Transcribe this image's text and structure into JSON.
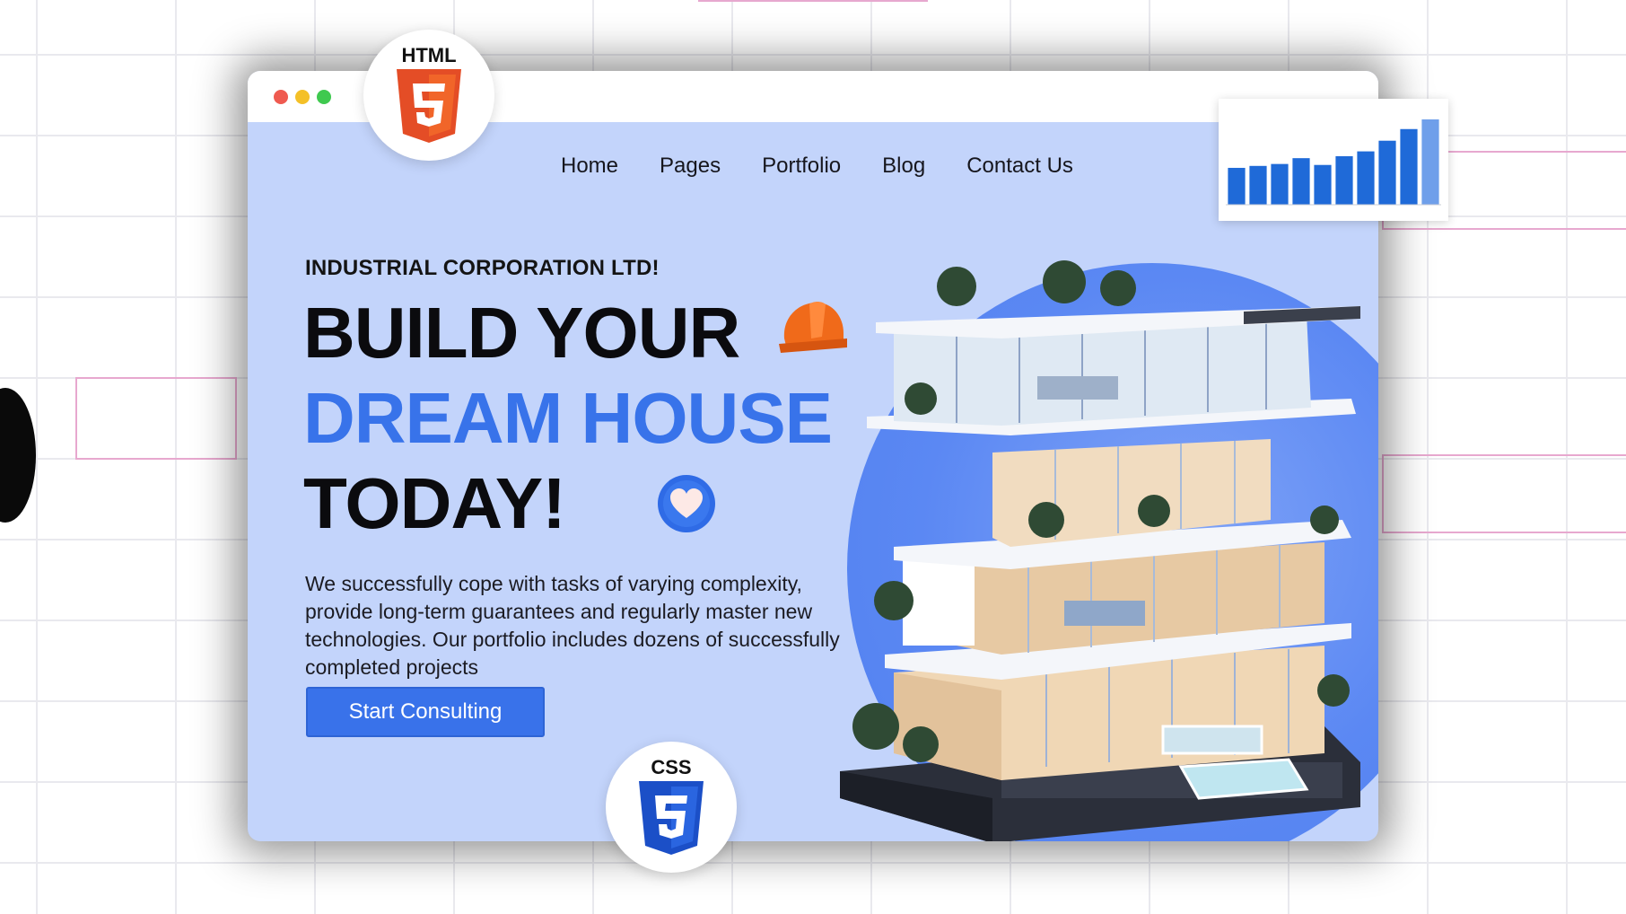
{
  "nav": {
    "items": [
      {
        "label": "Home"
      },
      {
        "label": "Pages"
      },
      {
        "label": "Portfolio"
      },
      {
        "label": "Blog"
      },
      {
        "label": "Contact Us"
      }
    ]
  },
  "hero": {
    "eyebrow": "INDUSTRIAL CORPORATION LTD!",
    "headline_line1": "BUILD YOUR",
    "headline_line2": "DREAM HOUSE",
    "headline_line3": "TODAY!",
    "description": "We successfully cope with tasks of varying complexity, provide long-term guarantees and regularly master new technologies. Our portfolio includes dozens of successfully completed projects",
    "cta_label": "Start Consulting"
  },
  "badges": {
    "html": {
      "label": "HTML",
      "icon": "html5-icon",
      "color": "#e44d26"
    },
    "css": {
      "label": "CSS",
      "icon": "css3-icon",
      "color": "#1572b6"
    }
  },
  "colors": {
    "page_bg": "#c3d4fb",
    "accent": "#3873ea",
    "headline_dark": "#0b0b0e"
  },
  "chart_data": {
    "type": "bar",
    "values": [
      38,
      40,
      42,
      48,
      41,
      50,
      55,
      66,
      78,
      88
    ],
    "bar_color": "#1f6ad8",
    "last_bar_color": "#6f9fea"
  }
}
